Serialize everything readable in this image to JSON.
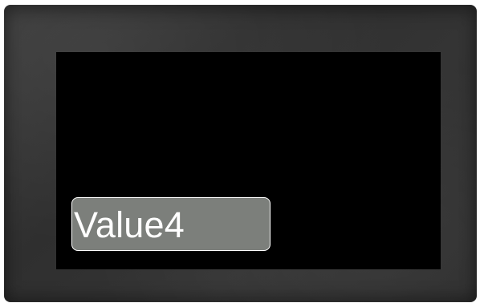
{
  "display": {
    "value_label": "Value4"
  },
  "colors": {
    "bezel": "#343434",
    "screen_background": "#000000",
    "value_box_background": "#7c7f7b",
    "value_box_border": "#ffffff",
    "value_text": "#ffffff"
  }
}
